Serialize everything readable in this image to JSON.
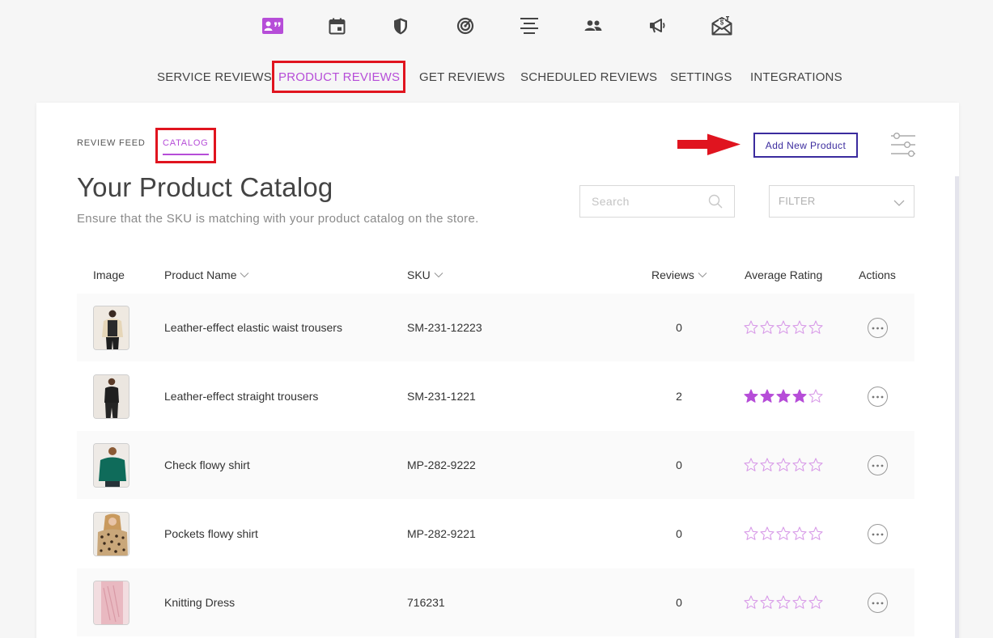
{
  "top_icons": [
    {
      "name": "reviews-card-icon",
      "color": "#b64dd8"
    },
    {
      "name": "calendar-icon",
      "color": "#444444"
    },
    {
      "name": "shield-icon",
      "color": "#444444"
    },
    {
      "name": "target-icon",
      "color": "#444444"
    },
    {
      "name": "align-center-icon",
      "color": "#444444"
    },
    {
      "name": "users-icon",
      "color": "#444444"
    },
    {
      "name": "megaphone-icon",
      "color": "#444444"
    },
    {
      "name": "envelope-money-icon",
      "color": "#444444"
    }
  ],
  "nav": {
    "items": [
      {
        "label": "SERVICE REVIEWS",
        "active": false
      },
      {
        "label": "PRODUCT REVIEWS",
        "active": true
      },
      {
        "label": "GET REVIEWS",
        "active": false
      },
      {
        "label": "SCHEDULED REVIEWS",
        "active": false
      },
      {
        "label": "SETTINGS",
        "active": false
      },
      {
        "label": "INTEGRATIONS",
        "active": false
      }
    ]
  },
  "subtabs": {
    "review_feed": "REVIEW FEED",
    "catalog": "CATALOG",
    "active": "CATALOG"
  },
  "toolbar": {
    "add_product_label": "Add New Product"
  },
  "page": {
    "title": "Your Product Catalog",
    "subtitle": "Ensure that the SKU is matching with your product catalog on the store."
  },
  "search": {
    "placeholder": "Search",
    "value": ""
  },
  "filter": {
    "label": "FILTER"
  },
  "table": {
    "columns": {
      "image": "Image",
      "product_name": "Product Name",
      "sku": "SKU",
      "reviews": "Reviews",
      "average_rating": "Average Rating",
      "actions": "Actions"
    },
    "rows": [
      {
        "name": "Leather-effect elastic waist trousers",
        "sku": "SM-231-12223",
        "reviews": "0",
        "rating": 0,
        "thumb": "beige-coat"
      },
      {
        "name": "Leather-effect straight trousers",
        "sku": "SM-231-1221",
        "reviews": "2",
        "rating": 4,
        "thumb": "black-outfit"
      },
      {
        "name": "Check flowy shirt",
        "sku": "MP-282-9222",
        "reviews": "0",
        "rating": 0,
        "thumb": "green-shirt"
      },
      {
        "name": "Pockets flowy shirt",
        "sku": "MP-282-9221",
        "reviews": "0",
        "rating": 0,
        "thumb": "leopard-shirt"
      },
      {
        "name": "Knitting Dress",
        "sku": "716231",
        "reviews": "0",
        "rating": 0,
        "thumb": "pink-dress"
      }
    ]
  },
  "colors": {
    "accent": "#b64dd8",
    "button_border": "#3b2b9e",
    "highlight": "#e0141f",
    "star_filled": "#b64dd8",
    "star_empty": "#d89be8"
  }
}
